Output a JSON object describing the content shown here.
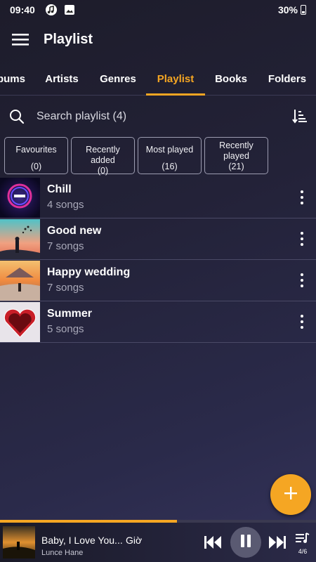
{
  "status_bar": {
    "time": "09:40",
    "battery": "30%",
    "icons": [
      "music-note-icon",
      "image-icon",
      "battery-icon"
    ]
  },
  "app_bar": {
    "title": "Playlist",
    "menu_icon": "hamburger-menu-icon"
  },
  "tabs": [
    {
      "label": "bums",
      "active": false
    },
    {
      "label": "Artists",
      "active": false
    },
    {
      "label": "Genres",
      "active": false
    },
    {
      "label": "Playlist",
      "active": true
    },
    {
      "label": "Books",
      "active": false
    },
    {
      "label": "Folders",
      "active": false
    }
  ],
  "search": {
    "placeholder": "Search playlist (4)",
    "icon": "search-icon",
    "sort_icon": "sort-icon"
  },
  "chips": [
    {
      "label": "Favourites",
      "count": "(0)"
    },
    {
      "label": "Recently added",
      "count": "(0)"
    },
    {
      "label": "Most played",
      "count": "(16)"
    },
    {
      "label": "Recently played",
      "count": "(21)"
    }
  ],
  "playlists": [
    {
      "title": "Chill",
      "subtitle": "4 songs"
    },
    {
      "title": "Good new",
      "subtitle": "7 songs"
    },
    {
      "title": "Happy wedding",
      "subtitle": "7 songs"
    },
    {
      "title": "Summer",
      "subtitle": "5 songs"
    }
  ],
  "fab": {
    "icon": "plus-icon"
  },
  "player": {
    "title": "Baby, I Love You...",
    "title_overflow": "Giờ",
    "artist": "Lunce Hane",
    "queue_count": "4/6",
    "progress": 0.56
  },
  "colors": {
    "accent": "#f5a623",
    "background": "#232238"
  }
}
